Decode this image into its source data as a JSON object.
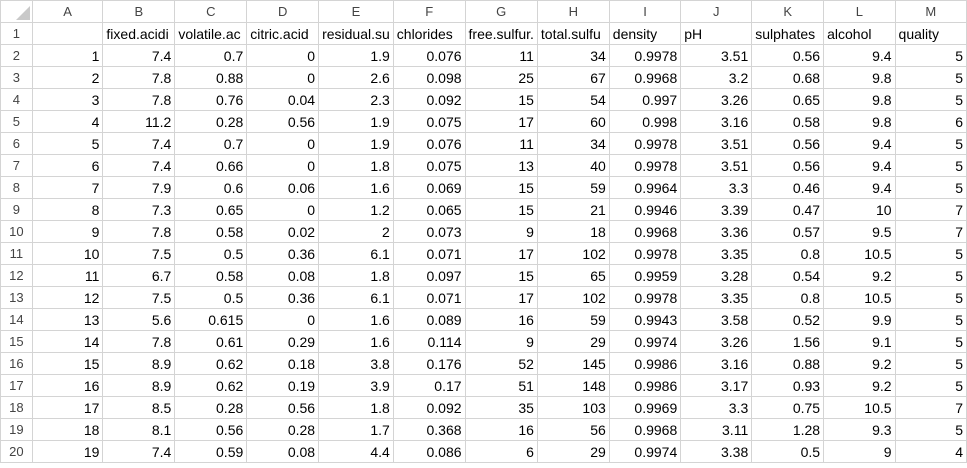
{
  "columns": [
    "A",
    "B",
    "C",
    "D",
    "E",
    "F",
    "G",
    "H",
    "I",
    "J",
    "K",
    "L",
    "M"
  ],
  "row_numbers": [
    "1",
    "2",
    "3",
    "4",
    "5",
    "6",
    "7",
    "8",
    "9",
    "10",
    "11",
    "12",
    "13",
    "14",
    "15",
    "16",
    "17",
    "18",
    "19",
    "20"
  ],
  "headers": [
    "",
    "fixed.acidi",
    "volatile.ac",
    "citric.acid",
    "residual.su",
    "chlorides",
    "free.sulfur.",
    "total.sulfu",
    "density",
    "pH",
    "sulphates",
    "alcohol",
    "quality"
  ],
  "rows": [
    [
      "1",
      "7.4",
      "0.7",
      "0",
      "1.9",
      "0.076",
      "11",
      "34",
      "0.9978",
      "3.51",
      "0.56",
      "9.4",
      "5"
    ],
    [
      "2",
      "7.8",
      "0.88",
      "0",
      "2.6",
      "0.098",
      "25",
      "67",
      "0.9968",
      "3.2",
      "0.68",
      "9.8",
      "5"
    ],
    [
      "3",
      "7.8",
      "0.76",
      "0.04",
      "2.3",
      "0.092",
      "15",
      "54",
      "0.997",
      "3.26",
      "0.65",
      "9.8",
      "5"
    ],
    [
      "4",
      "11.2",
      "0.28",
      "0.56",
      "1.9",
      "0.075",
      "17",
      "60",
      "0.998",
      "3.16",
      "0.58",
      "9.8",
      "6"
    ],
    [
      "5",
      "7.4",
      "0.7",
      "0",
      "1.9",
      "0.076",
      "11",
      "34",
      "0.9978",
      "3.51",
      "0.56",
      "9.4",
      "5"
    ],
    [
      "6",
      "7.4",
      "0.66",
      "0",
      "1.8",
      "0.075",
      "13",
      "40",
      "0.9978",
      "3.51",
      "0.56",
      "9.4",
      "5"
    ],
    [
      "7",
      "7.9",
      "0.6",
      "0.06",
      "1.6",
      "0.069",
      "15",
      "59",
      "0.9964",
      "3.3",
      "0.46",
      "9.4",
      "5"
    ],
    [
      "8",
      "7.3",
      "0.65",
      "0",
      "1.2",
      "0.065",
      "15",
      "21",
      "0.9946",
      "3.39",
      "0.47",
      "10",
      "7"
    ],
    [
      "9",
      "7.8",
      "0.58",
      "0.02",
      "2",
      "0.073",
      "9",
      "18",
      "0.9968",
      "3.36",
      "0.57",
      "9.5",
      "7"
    ],
    [
      "10",
      "7.5",
      "0.5",
      "0.36",
      "6.1",
      "0.071",
      "17",
      "102",
      "0.9978",
      "3.35",
      "0.8",
      "10.5",
      "5"
    ],
    [
      "11",
      "6.7",
      "0.58",
      "0.08",
      "1.8",
      "0.097",
      "15",
      "65",
      "0.9959",
      "3.28",
      "0.54",
      "9.2",
      "5"
    ],
    [
      "12",
      "7.5",
      "0.5",
      "0.36",
      "6.1",
      "0.071",
      "17",
      "102",
      "0.9978",
      "3.35",
      "0.8",
      "10.5",
      "5"
    ],
    [
      "13",
      "5.6",
      "0.615",
      "0",
      "1.6",
      "0.089",
      "16",
      "59",
      "0.9943",
      "3.58",
      "0.52",
      "9.9",
      "5"
    ],
    [
      "14",
      "7.8",
      "0.61",
      "0.29",
      "1.6",
      "0.114",
      "9",
      "29",
      "0.9974",
      "3.26",
      "1.56",
      "9.1",
      "5"
    ],
    [
      "15",
      "8.9",
      "0.62",
      "0.18",
      "3.8",
      "0.176",
      "52",
      "145",
      "0.9986",
      "3.16",
      "0.88",
      "9.2",
      "5"
    ],
    [
      "16",
      "8.9",
      "0.62",
      "0.19",
      "3.9",
      "0.17",
      "51",
      "148",
      "0.9986",
      "3.17",
      "0.93",
      "9.2",
      "5"
    ],
    [
      "17",
      "8.5",
      "0.28",
      "0.56",
      "1.8",
      "0.092",
      "35",
      "103",
      "0.9969",
      "3.3",
      "0.75",
      "10.5",
      "7"
    ],
    [
      "18",
      "8.1",
      "0.56",
      "0.28",
      "1.7",
      "0.368",
      "16",
      "56",
      "0.9968",
      "3.11",
      "1.28",
      "9.3",
      "5"
    ],
    [
      "19",
      "7.4",
      "0.59",
      "0.08",
      "4.4",
      "0.086",
      "6",
      "29",
      "0.9974",
      "3.38",
      "0.5",
      "9",
      "4"
    ]
  ]
}
